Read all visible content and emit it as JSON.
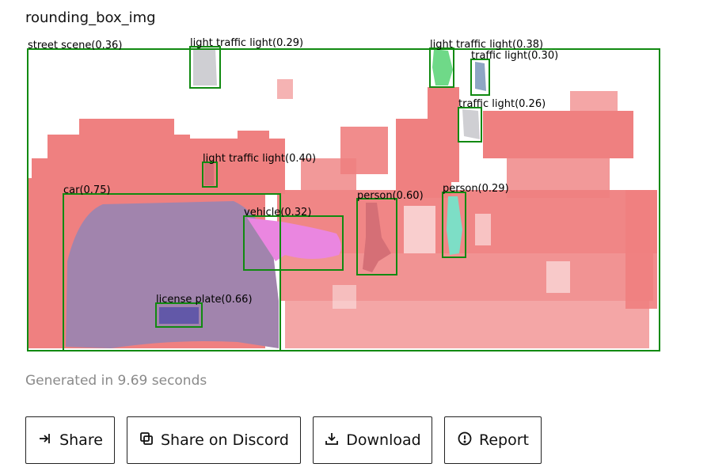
{
  "panel": {
    "title": "rounding_box_img"
  },
  "detections": [
    {
      "label": "street scene(0.36)"
    },
    {
      "label": "light traffic light(0.29)"
    },
    {
      "label": "light traffic light(0.38)"
    },
    {
      "label": "traffic light(0.30)"
    },
    {
      "label": "traffic light(0.26)"
    },
    {
      "label": "light traffic light(0.40)"
    },
    {
      "label": "car(0.75)"
    },
    {
      "label": "vehicle(0.32)"
    },
    {
      "label": "person(0.60)"
    },
    {
      "label": "person(0.29)"
    },
    {
      "label": "license plate(0.66)"
    }
  ],
  "colors": {
    "box": "#118a11",
    "scene_mask": "#ef8080",
    "car_mask": "#a184ad",
    "vehicle_mask": "#ea86e0",
    "plate_mask": "#6258a8",
    "traffic_gray": "#cfcfd3",
    "traffic_green": "#6fd988",
    "traffic_blue": "#8ea6c4",
    "person_red": "#d56f76",
    "person_teal": "#7ddec6"
  },
  "status": {
    "text": "Generated in 9.69 seconds"
  },
  "actions": {
    "share": "Share",
    "discord": "Share on Discord",
    "download": "Download",
    "report": "Report"
  }
}
